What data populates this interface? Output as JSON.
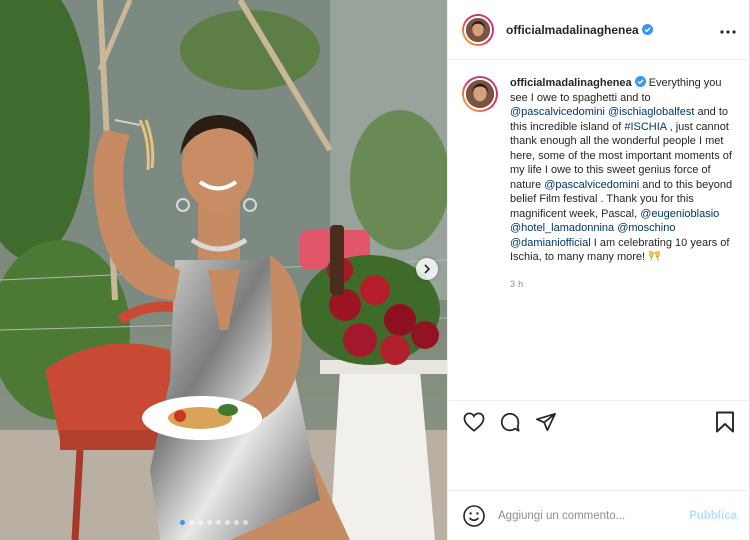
{
  "post": {
    "username": "officialmadalinaghenea",
    "verified": true,
    "more_icon": "more-horizontal-icon",
    "caption": [
      {
        "t": "text",
        "v": "Everything you see I owe to spaghetti and to "
      },
      {
        "t": "mention",
        "v": "@pascalvicedomini"
      },
      {
        "t": "text",
        "v": " "
      },
      {
        "t": "mention",
        "v": "@ischiaglobalfest"
      },
      {
        "t": "text",
        "v": " and to this incredible island of "
      },
      {
        "t": "mention",
        "v": "#ISCHIA"
      },
      {
        "t": "text",
        "v": " , just cannot thank enough all the wonderful people I met here, some of the most important moments of my life I owe to this sweet genius force of nature "
      },
      {
        "t": "mention",
        "v": "@pascalvicedomini"
      },
      {
        "t": "text",
        "v": " and to this beyond belief Film festival . Thank you for this magnificent week, Pascal, "
      },
      {
        "t": "mention",
        "v": "@eugenioblasio"
      },
      {
        "t": "text",
        "v": " "
      },
      {
        "t": "mention",
        "v": "@hotel_lamadonnina"
      },
      {
        "t": "text",
        "v": " "
      },
      {
        "t": "mention",
        "v": "@moschino"
      },
      {
        "t": "text",
        "v": " "
      },
      {
        "t": "mention",
        "v": "@damianiofficial"
      },
      {
        "t": "text",
        "v": " I am celebrating 10 years of Ischia, to many many more! "
      }
    ],
    "caption_emoji": "clinking-glasses-emoji",
    "time_ago": "3 h",
    "carousel": {
      "total": 8,
      "active": 1,
      "next_icon": "chevron-right-icon"
    }
  },
  "actions": {
    "like_icon": "heart-icon",
    "comment_icon": "comment-icon",
    "share_icon": "paper-plane-icon",
    "save_icon": "bookmark-icon"
  },
  "comment_box": {
    "placeholder": "Aggiungi un commento...",
    "submit_label": "Pubblica",
    "emoji_icon": "smiley-icon"
  },
  "colors": {
    "link": "#00376b",
    "verified": "#3897f0",
    "publish_disabled": "#b2dffc",
    "muted": "#8e8e8e"
  }
}
